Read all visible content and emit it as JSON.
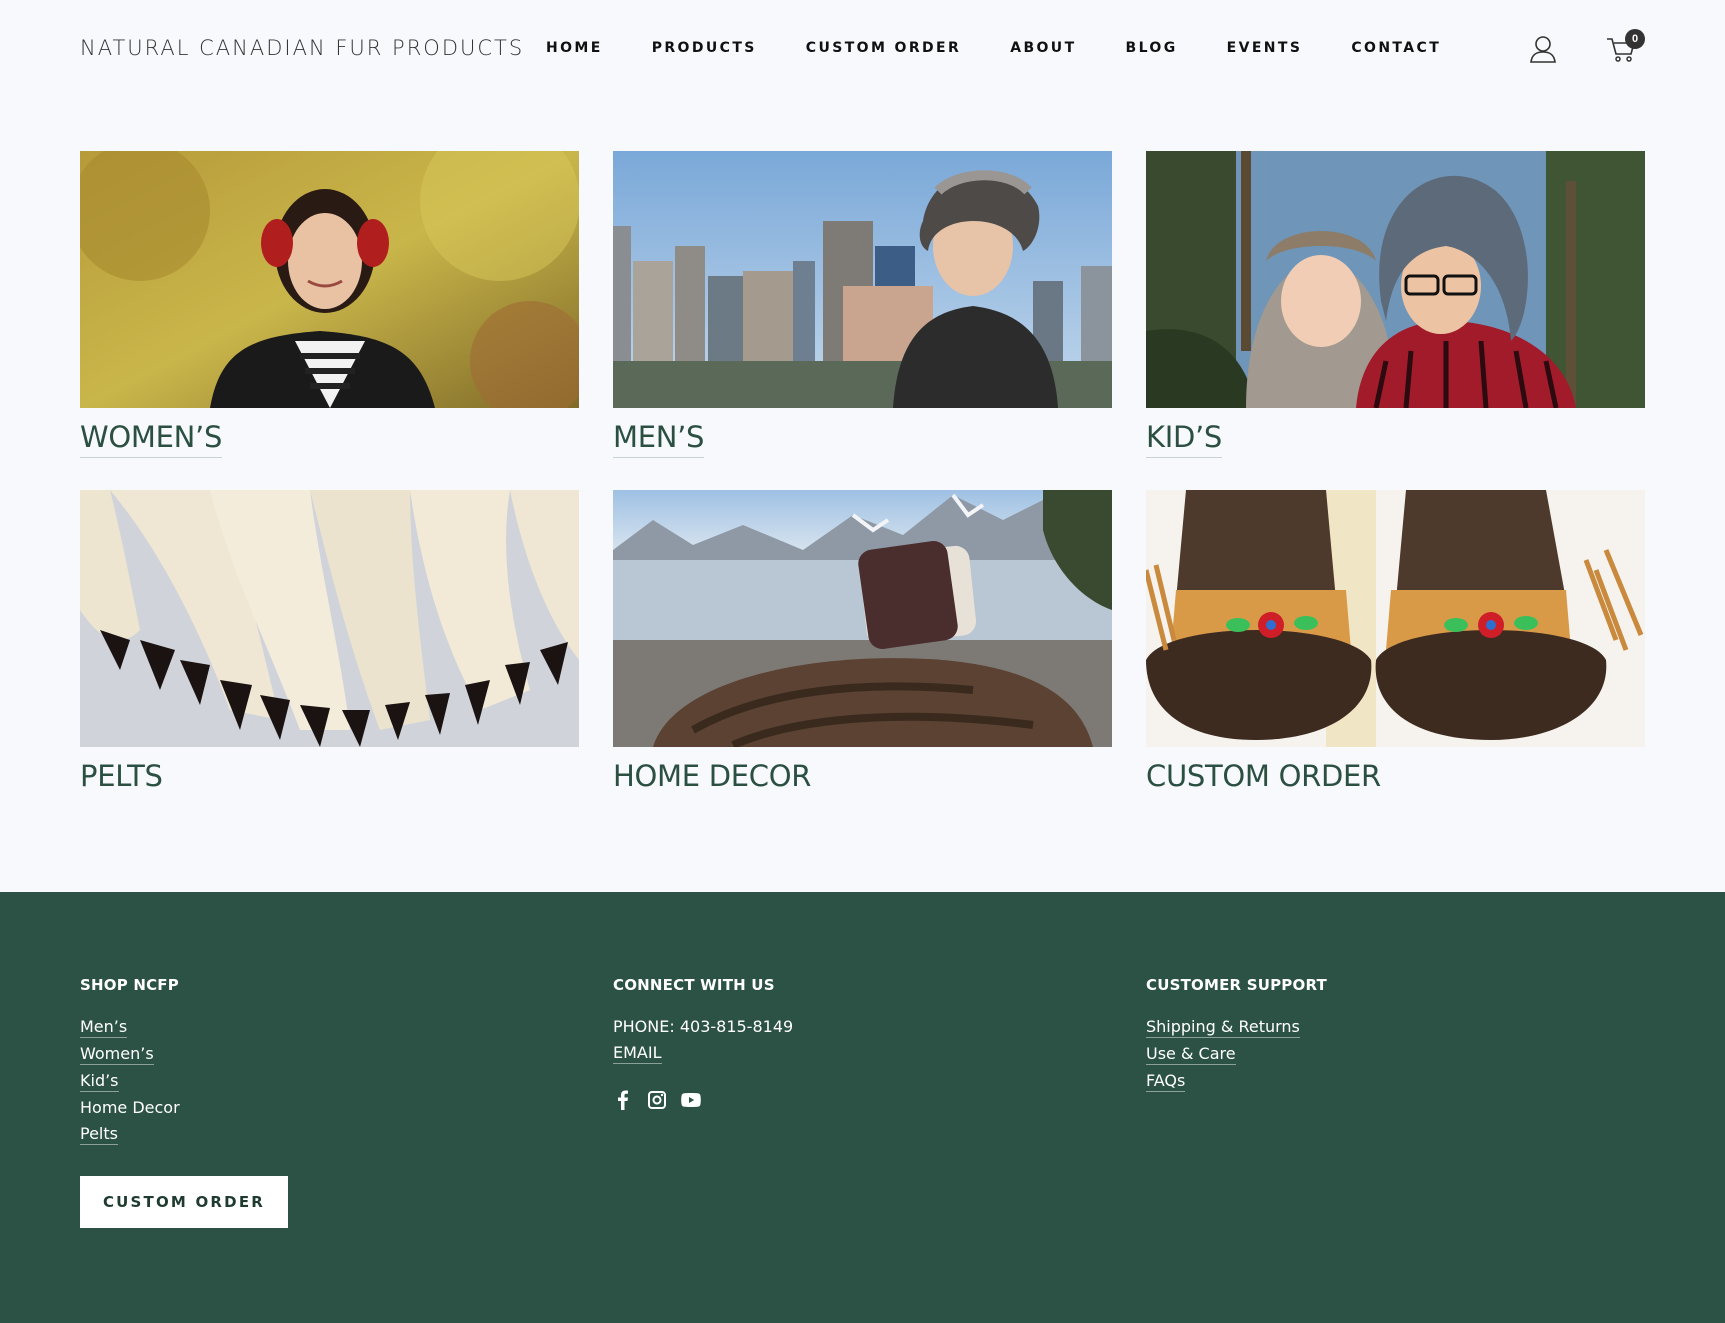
{
  "brand": {
    "logo": "NATURAL CANADIAN FUR PRODUCTS"
  },
  "nav": {
    "items": [
      "HOME",
      "PRODUCTS",
      "CUSTOM ORDER",
      "ABOUT",
      "BLOG",
      "EVENTS",
      "CONTACT"
    ]
  },
  "header": {
    "cart_count": "0",
    "account_icon": "user-icon",
    "cart_icon": "cart-icon"
  },
  "categories": [
    {
      "label": "WOMEN’S"
    },
    {
      "label": "MEN’S"
    },
    {
      "label": "KID’S"
    },
    {
      "label": "PELTS"
    },
    {
      "label": "HOME DECOR"
    },
    {
      "label": "CUSTOM ORDER"
    }
  ],
  "footer": {
    "shop": {
      "heading": "SHOP NCFP",
      "links": [
        "Men’s",
        "Women’s",
        "Kid’s",
        "Home Decor",
        "Pelts"
      ]
    },
    "connect": {
      "heading": "CONNECT WITH US",
      "phone": "PHONE: 403-815-8149",
      "email": "EMAIL",
      "social": [
        "facebook-icon",
        "instagram-icon",
        "youtube-icon"
      ]
    },
    "support": {
      "heading": "CUSTOMER SUPPORT",
      "links": [
        "Shipping & Returns",
        "Use & Care",
        "FAQs"
      ]
    },
    "button": "CUSTOM ORDER"
  },
  "colors": {
    "accent": "#2b5244",
    "caption": "#2b5042",
    "background": "#f8f9fc"
  }
}
